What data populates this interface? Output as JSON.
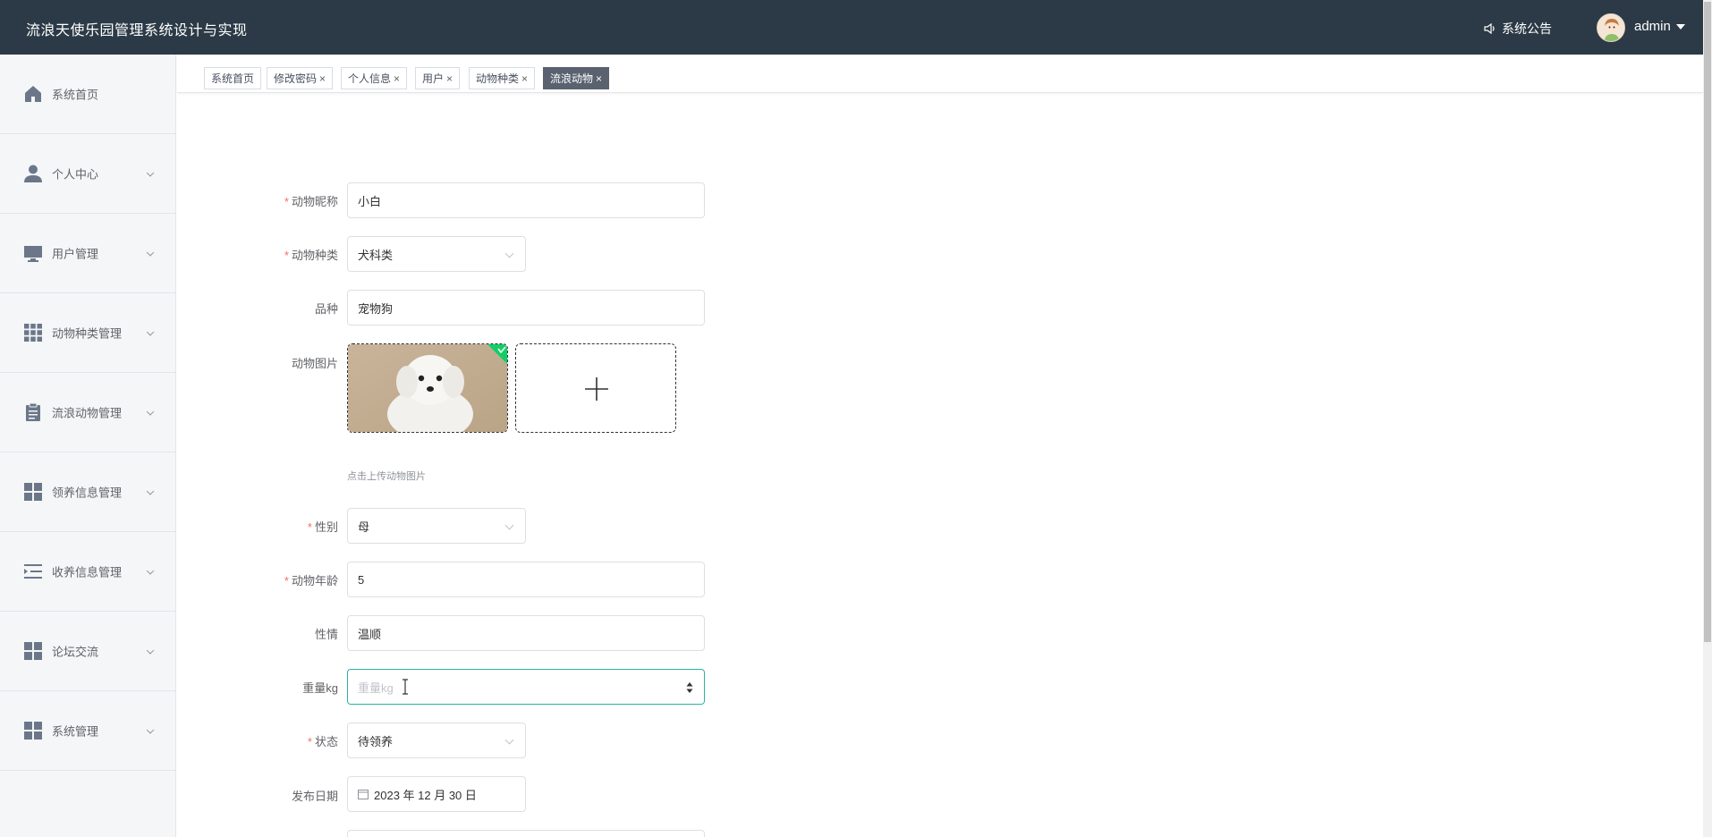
{
  "header": {
    "title": "流浪天使乐园管理系统设计与实现",
    "notice": "系统公告",
    "username": "admin"
  },
  "sidebar": {
    "items": [
      {
        "label": "系统首页",
        "icon": "home-icon",
        "has_arrow": false
      },
      {
        "label": "个人中心",
        "icon": "user-icon",
        "has_arrow": true
      },
      {
        "label": "用户管理",
        "icon": "monitor-icon",
        "has_arrow": true
      },
      {
        "label": "动物种类管理",
        "icon": "grid-icon",
        "has_arrow": true
      },
      {
        "label": "流浪动物管理",
        "icon": "clipboard-icon",
        "has_arrow": true
      },
      {
        "label": "领养信息管理",
        "icon": "apps-icon",
        "has_arrow": true
      },
      {
        "label": "收养信息管理",
        "icon": "list-indent-icon",
        "has_arrow": true
      },
      {
        "label": "论坛交流",
        "icon": "apps-icon",
        "has_arrow": true
      },
      {
        "label": "系统管理",
        "icon": "apps-icon",
        "has_arrow": true
      }
    ]
  },
  "tabs": [
    {
      "label": "系统首页",
      "closable": false,
      "active": false
    },
    {
      "label": "修改密码",
      "closable": true,
      "active": false
    },
    {
      "label": "个人信息",
      "closable": true,
      "active": false
    },
    {
      "label": "用户",
      "closable": true,
      "active": false
    },
    {
      "label": "动物种类",
      "closable": true,
      "active": false
    },
    {
      "label": "流浪动物",
      "closable": true,
      "active": true
    }
  ],
  "tab_close_glyph": "×",
  "form": {
    "name": {
      "label": "动物昵称",
      "required": true,
      "value": "小白"
    },
    "kind": {
      "label": "动物种类",
      "required": true,
      "value": "犬科类"
    },
    "breed": {
      "label": "品种",
      "required": false,
      "value": "宠物狗"
    },
    "image": {
      "label": "动物图片",
      "required": false,
      "tip": "点击上传动物图片"
    },
    "gender": {
      "label": "性别",
      "required": true,
      "value": "母"
    },
    "age": {
      "label": "动物年龄",
      "required": true,
      "value": "5"
    },
    "temper": {
      "label": "性情",
      "required": false,
      "value": "温顺"
    },
    "weight": {
      "label": "重量kg",
      "required": false,
      "value": "",
      "placeholder": "重量kg"
    },
    "status": {
      "label": "状态",
      "required": true,
      "value": "待领养"
    },
    "date": {
      "label": "发布日期",
      "required": false,
      "value": "2023 年 12 月 30 日"
    }
  },
  "required_mark": "*",
  "colors": {
    "header_bg": "#2c3a47",
    "active_tab": "#5a6270",
    "focus_border": "#2ab3a6",
    "required": "#f56c6c",
    "upload_success_badge": "#13ce66"
  }
}
